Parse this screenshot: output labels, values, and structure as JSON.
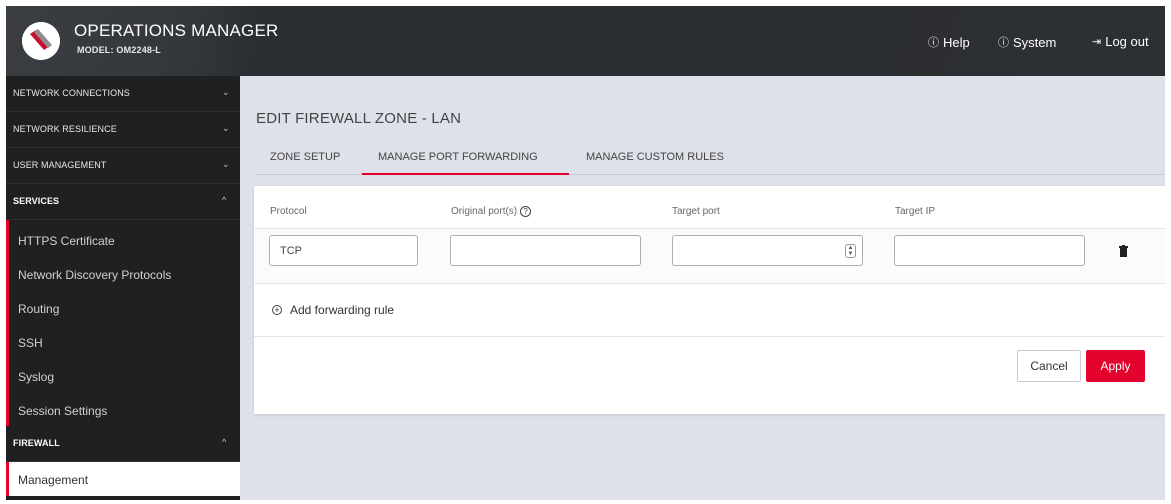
{
  "header": {
    "title": "OPERATIONS MANAGER",
    "model": "MODEL: OM2248-L",
    "links": [
      {
        "icon": "help-icon",
        "glyph": "?",
        "label": "Help"
      },
      {
        "icon": "info-icon",
        "glyph": "i",
        "label": "System"
      },
      {
        "icon": "logout-icon",
        "glyph": "⇥",
        "label": "Log out"
      }
    ]
  },
  "sidebar": {
    "sections": [
      {
        "label": "NETWORK CONNECTIONS",
        "expanded": false
      },
      {
        "label": "NETWORK RESILIENCE",
        "expanded": false
      },
      {
        "label": "USER MANAGEMENT",
        "expanded": false
      },
      {
        "label": "SERVICES",
        "expanded": true
      },
      {
        "label": "FIREWALL",
        "expanded": true
      }
    ],
    "services_items": [
      "HTTPS Certificate",
      "Network Discovery Protocols",
      "Routing",
      "SSH",
      "Syslog",
      "Session Settings"
    ],
    "firewall_items": [
      "Management"
    ],
    "active_item": "Management",
    "chevron_down": "⌄",
    "chevron_up": "^"
  },
  "main": {
    "page_title": "EDIT FIREWALL ZONE - LAN",
    "tabs": [
      {
        "label": "ZONE SETUP",
        "active": false
      },
      {
        "label": "MANAGE PORT FORWARDING",
        "active": true
      },
      {
        "label": "MANAGE CUSTOM RULES",
        "active": false
      }
    ],
    "columns": {
      "protocol": "Protocol",
      "original_ports": "Original port(s)",
      "target_port": "Target port",
      "target_ip": "Target IP"
    },
    "row": {
      "protocol_value": "TCP",
      "original_ports_value": "",
      "target_port_value": "",
      "target_ip_value": ""
    },
    "add_rule_label": "Add forwarding rule",
    "cancel_label": "Cancel",
    "apply_label": "Apply"
  },
  "colors": {
    "accent": "#e4032d",
    "header_bg": "#2c2f33",
    "sidebar_bg": "#1e2022",
    "content_bg": "#dfe1ea"
  }
}
